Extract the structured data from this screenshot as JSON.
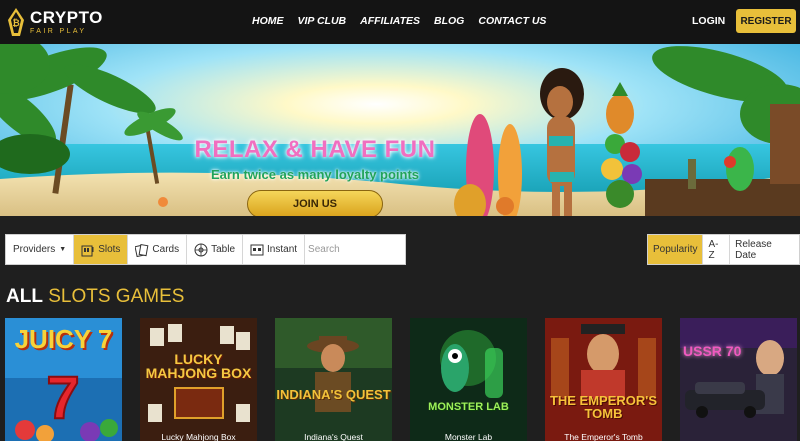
{
  "header": {
    "logo_main": "CRYPTO",
    "logo_sub": "FAIR PLAY",
    "nav": [
      "HOME",
      "VIP CLUB",
      "AFFILIATES",
      "BLOG",
      "CONTACT US"
    ],
    "login": "LOGIN",
    "register": "REGISTER"
  },
  "banner": {
    "headline": "RELAX & HAVE FUN",
    "subline": "Earn twice as many loyalty points",
    "cta": "JOIN US"
  },
  "filters": {
    "providers": "Providers",
    "slots": "Slots",
    "cards": "Cards",
    "table": "Table",
    "instant": "Instant",
    "search_placeholder": "Search"
  },
  "sort": [
    "Popularity",
    "A-Z",
    "Release Date"
  ],
  "section": {
    "prefix": "ALL",
    "suffix": "SLOTS GAMES"
  },
  "games": [
    {
      "name": "",
      "art": "JUICY 7"
    },
    {
      "name": "Lucky Mahjong Box",
      "art": "LUCKY MAHJONG BOX"
    },
    {
      "name": "Indiana's Quest",
      "art": "INDIANA'S QUEST"
    },
    {
      "name": "Monster Lab",
      "art": "MONSTER LAB"
    },
    {
      "name": "The Emperor's Tomb",
      "art": "THE EMPEROR'S TOMB"
    },
    {
      "name": "",
      "art": "USSR 70"
    }
  ],
  "colors": {
    "accent": "#e8bf3a",
    "header_bg": "#141414",
    "page_bg": "#1f1f1f",
    "headline_pink": "#f06fc0",
    "subline_green": "#20a35a"
  }
}
